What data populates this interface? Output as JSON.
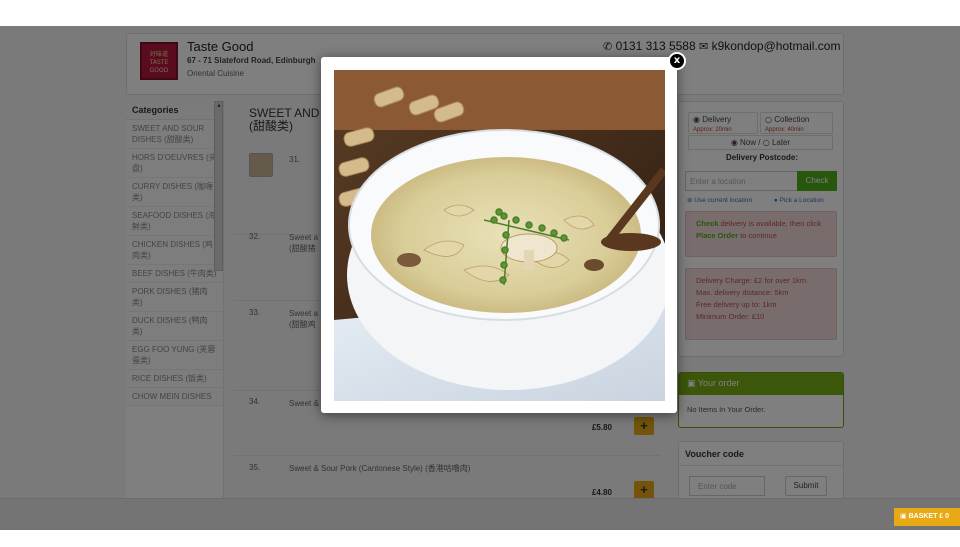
{
  "header": {
    "logo_text": "好味道 TASTE GOOD",
    "name": "Taste Good",
    "address": "67 - 71 Slateford Road, Edinburgh",
    "cuisine": "Oriental Cuisine",
    "phone": "0131 313 5588",
    "email": "k9kondop@hotmail.com"
  },
  "categories": {
    "title": "Categories",
    "items": [
      {
        "label": "SWEET AND SOUR DISHES (甜酸类)"
      },
      {
        "label": "HORS D'OEUVRES (头盘)"
      },
      {
        "label": "CURRY DISHES (咖喱类)"
      },
      {
        "label": "SEAFOOD DISHES (海鲜类)"
      },
      {
        "label": "CHICKEN DISHES (鸡肉类)"
      },
      {
        "label": "BEEF DISHES (牛肉类)"
      },
      {
        "label": "PORK DISHES (猪肉类)"
      },
      {
        "label": "DUCK DISHES (鸭肉类)"
      },
      {
        "label": "EGG FOO YUNG (芙蓉蛋类)"
      },
      {
        "label": "RICE DISHES (饭类)"
      },
      {
        "label": "CHOW MEIN DISHES"
      }
    ]
  },
  "menu": {
    "title_line1": "SWEET AND S",
    "title_line2": "(甜酸类)",
    "dishes": [
      {
        "num": "31.",
        "name": "",
        "price": ""
      },
      {
        "num": "32.",
        "name": "Sweet a",
        "name2": "(甜酸猪",
        "price": ""
      },
      {
        "num": "33.",
        "name": "Sweet a",
        "name2": "(甜酸鸡",
        "price": ""
      },
      {
        "num": "34.",
        "name": "Sweet &",
        "price": "£5.80"
      },
      {
        "num": "35.",
        "name": "Sweet & Sour Pork (Cantonese Style) (香港咕噜肉)",
        "price": "£4.80"
      }
    ],
    "add_symbol": "+"
  },
  "delivery": {
    "delivery_label": "Delivery",
    "delivery_approx": "Approx: 20min",
    "collection_label": "Collection",
    "collection_approx": "Approx: 40min",
    "time_now": "Now",
    "time_later": "Later",
    "postcode_label": "Delivery Postcode:",
    "location_placeholder": "Enter a location",
    "check_label": "Check",
    "use_current": "Use current location",
    "pick_location": "Pick a Location",
    "alert1_word1": "Check",
    "alert1_text1": "delivery is available, then click",
    "alert1_word2": "Place Order",
    "alert1_text2": "to continue",
    "charge": "Delivery Charge: £2 for over 1km.",
    "max_distance": "Max. delivery distance: 5km",
    "free": "Free delivery up to: 1km",
    "minimum": "Minimum Order: £10"
  },
  "order": {
    "title": "Your order",
    "empty": "No Items In Your Order."
  },
  "voucher": {
    "title": "Voucher code",
    "placeholder": "Enter code",
    "submit": "Submit"
  },
  "basket": {
    "label": "BASKET £ 0"
  },
  "modal": {
    "close_symbol": "x",
    "image_description_icon": "soup-bowl-photo"
  },
  "colors": {
    "accent_green": "#78ad14",
    "button_orange": "#e8a915",
    "alert_red": "#b5524e"
  }
}
